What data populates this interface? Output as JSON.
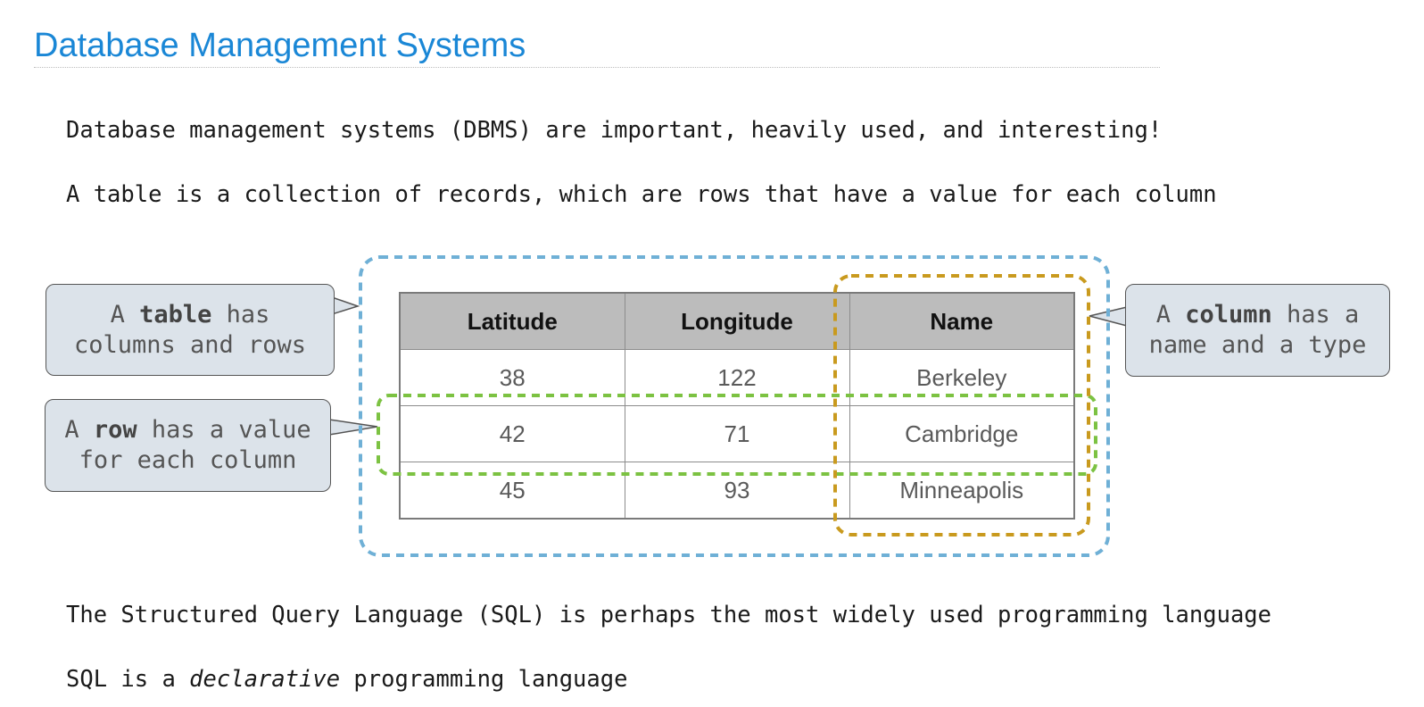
{
  "slide": {
    "title": "Database Management Systems",
    "bullets": {
      "dbms": "Database management systems (DBMS) are important, heavily used, and interesting!",
      "table_def": "A table is a collection of records, which are rows that have a value for each column",
      "sql_use": "The Structured Query Language (SQL) is perhaps the most widely used programming language",
      "sql_prefix": "SQL is a ",
      "sql_em": "declarative",
      "sql_suffix": " programming language"
    }
  },
  "table": {
    "headers": [
      "Latitude",
      "Longitude",
      "Name"
    ],
    "rows": [
      [
        "38",
        "122",
        "Berkeley"
      ],
      [
        "42",
        "71",
        "Cambridge"
      ],
      [
        "45",
        "93",
        "Minneapolis"
      ]
    ]
  },
  "callouts": {
    "table": {
      "pre": "A ",
      "bold": "table",
      "post1": " has",
      "line2": "columns and rows"
    },
    "row": {
      "pre": "A ",
      "bold": "row",
      "post1": " has a value",
      "line2": "for each column"
    },
    "column": {
      "pre": "A ",
      "bold": "column",
      "post1": " has a",
      "line2": "name and a type"
    }
  },
  "colors": {
    "title": "#1a87d6",
    "table_outline": "#6fb0d6",
    "row_outline": "#7cc242",
    "column_outline": "#c99a1e",
    "callout_bg": "#dce3ea"
  }
}
